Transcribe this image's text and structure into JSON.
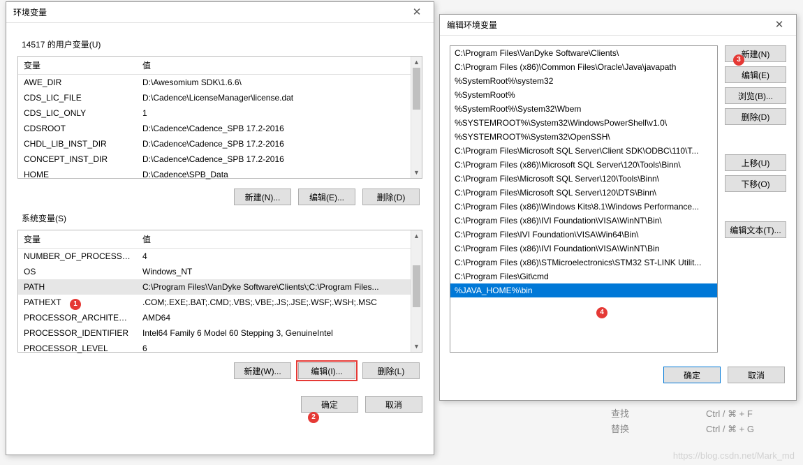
{
  "env_dialog": {
    "title": "环境变量",
    "close": "✕",
    "user_section_label": "14517 的用户变量(U)",
    "system_section_label": "系统变量(S)",
    "col_var": "变量",
    "col_val": "值",
    "user_vars": [
      {
        "name": "AWE_DIR",
        "value": "D:\\Awesomium SDK\\1.6.6\\"
      },
      {
        "name": "CDS_LIC_FILE",
        "value": "D:\\Cadence\\LicenseManager\\license.dat"
      },
      {
        "name": "CDS_LIC_ONLY",
        "value": "1"
      },
      {
        "name": "CDSROOT",
        "value": "D:\\Cadence\\Cadence_SPB 17.2-2016"
      },
      {
        "name": "CHDL_LIB_INST_DIR",
        "value": "D:\\Cadence\\Cadence_SPB 17.2-2016"
      },
      {
        "name": "CONCEPT_INST_DIR",
        "value": "D:\\Cadence\\Cadence_SPB 17.2-2016"
      },
      {
        "name": "HOME",
        "value": "D:\\Cadence\\SPB_Data"
      }
    ],
    "sys_vars": [
      {
        "name": "NUMBER_OF_PROCESSORS",
        "value": "4"
      },
      {
        "name": "OS",
        "value": "Windows_NT"
      },
      {
        "name": "PATH",
        "value": "C:\\Program Files\\VanDyke Software\\Clients\\;C:\\Program Files...",
        "selected": true
      },
      {
        "name": "PATHEXT",
        "value": ".COM;.EXE;.BAT;.CMD;.VBS;.VBE;.JS;.JSE;.WSF;.WSH;.MSC"
      },
      {
        "name": "PROCESSOR_ARCHITECT...",
        "value": "AMD64"
      },
      {
        "name": "PROCESSOR_IDENTIFIER",
        "value": "Intel64 Family 6 Model 60 Stepping 3, GenuineIntel"
      },
      {
        "name": "PROCESSOR_LEVEL",
        "value": "6"
      }
    ],
    "btn_new_user": "新建(N)...",
    "btn_edit_user": "编辑(E)...",
    "btn_del_user": "删除(D)",
    "btn_new_sys": "新建(W)...",
    "btn_edit_sys": "编辑(I)...",
    "btn_del_sys": "删除(L)",
    "btn_ok": "确定",
    "btn_cancel": "取消"
  },
  "edit_dialog": {
    "title": "编辑环境变量",
    "close": "✕",
    "items": [
      "C:\\Program Files\\VanDyke Software\\Clients\\",
      "C:\\Program Files (x86)\\Common Files\\Oracle\\Java\\javapath",
      "%SystemRoot%\\system32",
      "%SystemRoot%",
      "%SystemRoot%\\System32\\Wbem",
      "%SYSTEMROOT%\\System32\\WindowsPowerShell\\v1.0\\",
      "%SYSTEMROOT%\\System32\\OpenSSH\\",
      "C:\\Program Files\\Microsoft SQL Server\\Client SDK\\ODBC\\110\\T...",
      "C:\\Program Files (x86)\\Microsoft SQL Server\\120\\Tools\\Binn\\",
      "C:\\Program Files\\Microsoft SQL Server\\120\\Tools\\Binn\\",
      "C:\\Program Files\\Microsoft SQL Server\\120\\DTS\\Binn\\",
      "C:\\Program Files (x86)\\Windows Kits\\8.1\\Windows Performance...",
      "C:\\Program Files (x86)\\IVI Foundation\\VISA\\WinNT\\Bin\\",
      "C:\\Program Files\\IVI Foundation\\VISA\\Win64\\Bin\\",
      "C:\\Program Files (x86)\\IVI Foundation\\VISA\\WinNT\\Bin",
      "C:\\Program Files (x86)\\STMicroelectronics\\STM32 ST-LINK Utilit...",
      "C:\\Program Files\\Git\\cmd",
      "%JAVA_HOME%\\bin"
    ],
    "selected_index": 17,
    "btn_new": "新建(N)",
    "btn_edit": "编辑(E)",
    "btn_browse": "浏览(B)...",
    "btn_del": "删除(D)",
    "btn_up": "上移(U)",
    "btn_down": "下移(O)",
    "btn_edit_text": "编辑文本(T)...",
    "btn_ok": "确定",
    "btn_cancel": "取消"
  },
  "markers": {
    "m1": "1",
    "m2": "2",
    "m3": "3",
    "m4": "4"
  },
  "bg": {
    "find": "查找",
    "find_key": "Ctrl / ⌘ + F",
    "replace": "替换",
    "replace_key": "Ctrl / ⌘ + G"
  },
  "watermark": "https://blog.csdn.net/Mark_md"
}
